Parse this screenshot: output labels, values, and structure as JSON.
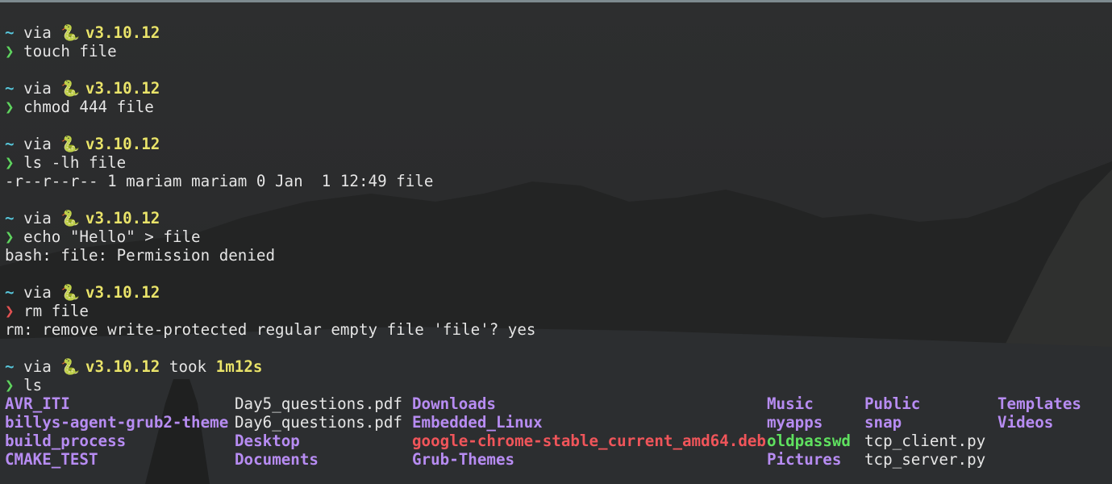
{
  "colors": {
    "directory": "#b78cf2",
    "prompt_ok": "#5fd35f",
    "prompt_err": "#e05252",
    "version": "#e9e36a",
    "deb_archive": "#f0555a",
    "executable": "#5fe05f"
  },
  "prompt": {
    "dir": "~",
    "via": "via",
    "snake": "🐍",
    "version": "v3.10.12",
    "chevron": "❯"
  },
  "blocks": [
    {
      "command": "touch file",
      "output": []
    },
    {
      "command": "chmod 444 file",
      "output": []
    },
    {
      "command": "ls -lh file",
      "output": [
        "-r--r--r-- 1 mariam mariam 0 Jan  1 12:49 file"
      ]
    },
    {
      "command": "echo \"Hello\" > file",
      "output": [
        "bash: file: Permission denied"
      ]
    },
    {
      "command": "rm file",
      "output": [
        "rm: remove write-protected regular empty file 'file'? yes"
      ]
    }
  ],
  "last_prompt": {
    "took": "took",
    "duration": "1m12s",
    "command": "ls"
  },
  "ls_listing": {
    "col1": [
      "AVR_ITI",
      "billys-agent-grub2-theme",
      "build_process",
      "CMAKE_TEST"
    ],
    "col2": [
      "Day5_questions.pdf",
      "Day6_questions.pdf",
      "Desktop",
      "Documents"
    ],
    "col3": [
      "Downloads",
      "Embedded_Linux",
      "google-chrome-stable_current_amd64.deb",
      "Grub-Themes"
    ],
    "col4": [
      "Music",
      "myapps",
      "oldpasswd",
      "Pictures"
    ],
    "col5": [
      "Public",
      "snap",
      "tcp_client.py",
      "tcp_server.py"
    ],
    "col6": [
      "Templates",
      "Videos"
    ]
  }
}
